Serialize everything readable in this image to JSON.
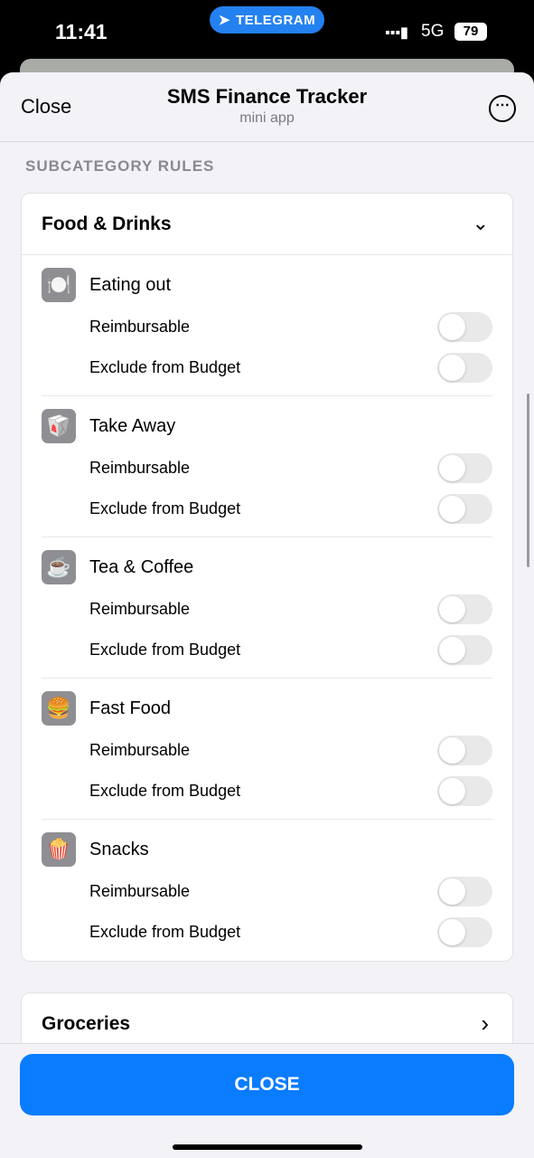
{
  "status": {
    "time": "11:41",
    "app_pill": "TELEGRAM",
    "network": "5G",
    "battery": "79",
    "signal": "▪▪▪▮"
  },
  "header": {
    "close": "Close",
    "title": "SMS Finance Tracker",
    "subtitle": "mini app",
    "more": "⋯"
  },
  "section_label": "SUBCATEGORY RULES",
  "category": {
    "title": "Food & Drinks",
    "expanded": true,
    "items": [
      {
        "name": "Eating out",
        "icon": "🍽️",
        "reimbursable": false,
        "exclude_budget": false
      },
      {
        "name": "Take Away",
        "icon": "🥡",
        "reimbursable": false,
        "exclude_budget": false
      },
      {
        "name": "Tea & Coffee",
        "icon": "☕",
        "reimbursable": false,
        "exclude_budget": false
      },
      {
        "name": "Fast Food",
        "icon": "🍔",
        "reimbursable": false,
        "exclude_budget": false
      },
      {
        "name": "Snacks",
        "icon": "🍿",
        "reimbursable": false,
        "exclude_budget": false
      }
    ]
  },
  "labels": {
    "reimbursable": "Reimbursable",
    "exclude": "Exclude from Budget"
  },
  "next_category": {
    "title": "Groceries"
  },
  "close_button": "CLOSE"
}
